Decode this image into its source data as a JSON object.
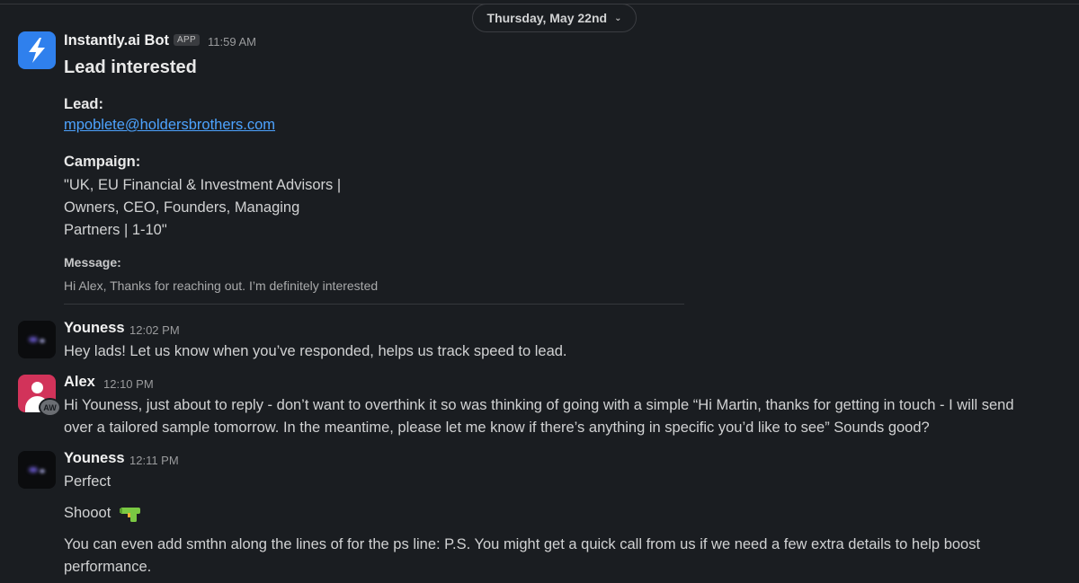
{
  "date_divider": {
    "label": "Thursday, May 22nd",
    "chevron_icon": "chevron-down-icon"
  },
  "messages": [
    {
      "author": "Instantly.ai Bot",
      "badge": "APP",
      "time": "11:59 AM",
      "avatar_icon": "lightning-bolt-icon",
      "title": "Lead interested",
      "lead_label": "Lead:",
      "lead_email": "mpoblete@holdersbrothers.com",
      "campaign_label": "Campaign:",
      "campaign_lines": [
        "\"UK, EU Financial & Investment Advisors |",
        "Owners, CEO, Founders, Managing",
        "Partners | 1-10\""
      ],
      "message_label": "Message:",
      "message_text": "Hi Alex,  Thanks for reaching out. I’m definitely interested"
    },
    {
      "author": "Youness",
      "time": "12:02 PM",
      "text": "Hey lads! Let us know when you’ve responded, helps us track speed to lead."
    },
    {
      "author": "Alex",
      "time": "12:10 PM",
      "avatar_badge": "AW",
      "lines": [
        "Hi Youness, just about to reply - don’t want to overthink it so was thinking of going with a simple “Hi Martin, thanks for getting in touch - I will send",
        "over a tailored sample tomorrow. In the meantime, please let me know if there’s anything in specific you’d like to see” Sounds good?"
      ]
    },
    {
      "author": "Youness",
      "time": "12:11 PM",
      "line1": "Perfect",
      "line2": "Shooot",
      "emoji_icon": "water-pistol-icon",
      "line3": [
        "You can even add smthn along the lines of for the ps line: P.S. You might get a quick call from us if we need a few extra details to help boost",
        "performance."
      ]
    }
  ],
  "colors": {
    "background": "#1a1d21",
    "link": "#4da3ff",
    "bot_avatar": "#2f80ed",
    "alex_avatar": "#d2335a"
  }
}
